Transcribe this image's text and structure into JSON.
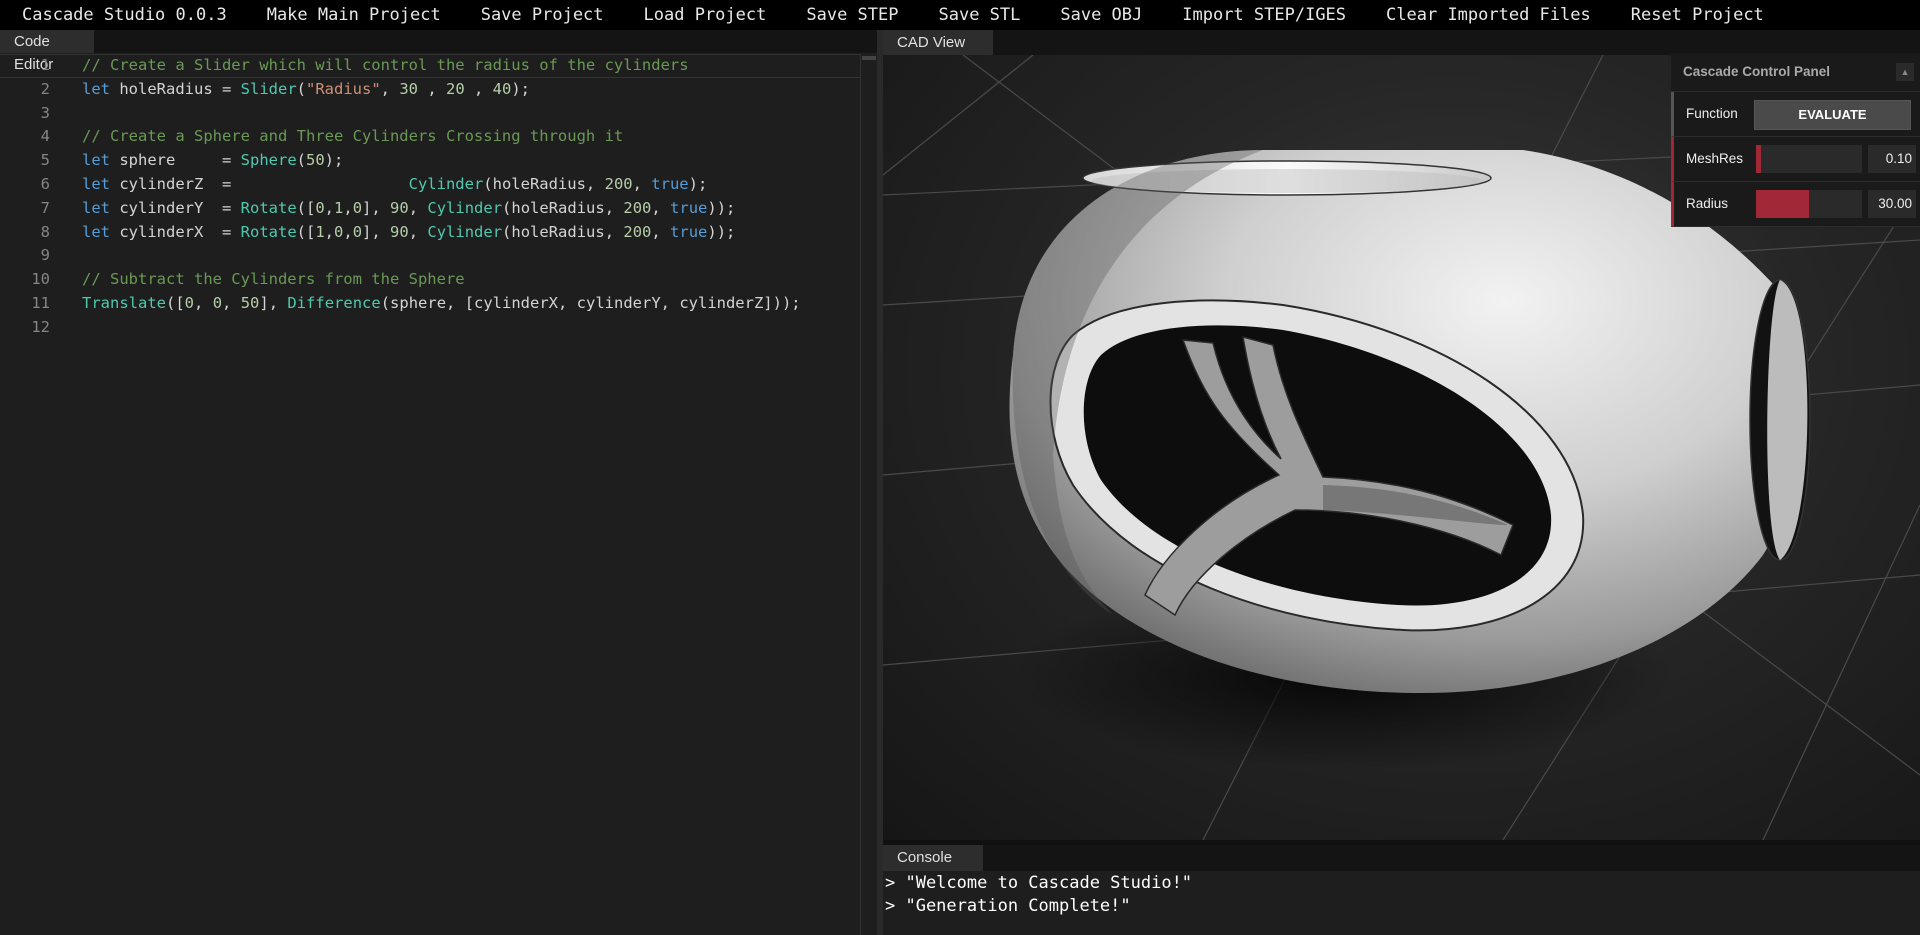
{
  "menu": {
    "app_title": "Cascade Studio 0.0.3",
    "items": [
      "Make Main Project",
      "Save Project",
      "Load Project",
      "Save STEP",
      "Save STL",
      "Save OBJ",
      "Import STEP/IGES",
      "Clear Imported Files",
      "Reset Project"
    ]
  },
  "editor": {
    "tab_label": "Code Editor",
    "lines": [
      {
        "n": "1",
        "tokens": [
          [
            "c-com",
            "// Create a Slider which will control the radius of the cylinders"
          ]
        ]
      },
      {
        "n": "2",
        "tokens": [
          [
            "c-kw",
            "let"
          ],
          [
            "c-id",
            " holeRadius = "
          ],
          [
            "c-fn",
            "Slider"
          ],
          [
            "c-id",
            "("
          ],
          [
            "c-str",
            "\"Radius\""
          ],
          [
            "c-id",
            ", "
          ],
          [
            "c-num",
            "30"
          ],
          [
            "c-id",
            " , "
          ],
          [
            "c-num",
            "20"
          ],
          [
            "c-id",
            " , "
          ],
          [
            "c-num",
            "40"
          ],
          [
            "c-id",
            ");"
          ]
        ]
      },
      {
        "n": "3",
        "tokens": []
      },
      {
        "n": "4",
        "tokens": [
          [
            "c-com",
            "// Create a Sphere and Three Cylinders Crossing through it"
          ]
        ]
      },
      {
        "n": "5",
        "tokens": [
          [
            "c-kw",
            "let"
          ],
          [
            "c-id",
            " sphere     = "
          ],
          [
            "c-fn",
            "Sphere"
          ],
          [
            "c-id",
            "("
          ],
          [
            "c-num",
            "50"
          ],
          [
            "c-id",
            ");"
          ]
        ]
      },
      {
        "n": "6",
        "tokens": [
          [
            "c-kw",
            "let"
          ],
          [
            "c-id",
            " cylinderZ  =                   "
          ],
          [
            "c-fn",
            "Cylinder"
          ],
          [
            "c-id",
            "(holeRadius, "
          ],
          [
            "c-num",
            "200"
          ],
          [
            "c-id",
            ", "
          ],
          [
            "c-kw",
            "true"
          ],
          [
            "c-id",
            ");"
          ]
        ]
      },
      {
        "n": "7",
        "tokens": [
          [
            "c-kw",
            "let"
          ],
          [
            "c-id",
            " cylinderY  = "
          ],
          [
            "c-fn",
            "Rotate"
          ],
          [
            "c-id",
            "(["
          ],
          [
            "c-num",
            "0"
          ],
          [
            "c-id",
            ","
          ],
          [
            "c-num",
            "1"
          ],
          [
            "c-id",
            ","
          ],
          [
            "c-num",
            "0"
          ],
          [
            "c-id",
            "], "
          ],
          [
            "c-num",
            "90"
          ],
          [
            "c-id",
            ", "
          ],
          [
            "c-fn",
            "Cylinder"
          ],
          [
            "c-id",
            "(holeRadius, "
          ],
          [
            "c-num",
            "200"
          ],
          [
            "c-id",
            ", "
          ],
          [
            "c-kw",
            "true"
          ],
          [
            "c-id",
            "));"
          ]
        ]
      },
      {
        "n": "8",
        "tokens": [
          [
            "c-kw",
            "let"
          ],
          [
            "c-id",
            " cylinderX  = "
          ],
          [
            "c-fn",
            "Rotate"
          ],
          [
            "c-id",
            "(["
          ],
          [
            "c-num",
            "1"
          ],
          [
            "c-id",
            ","
          ],
          [
            "c-num",
            "0"
          ],
          [
            "c-id",
            ","
          ],
          [
            "c-num",
            "0"
          ],
          [
            "c-id",
            "], "
          ],
          [
            "c-num",
            "90"
          ],
          [
            "c-id",
            ", "
          ],
          [
            "c-fn",
            "Cylinder"
          ],
          [
            "c-id",
            "(holeRadius, "
          ],
          [
            "c-num",
            "200"
          ],
          [
            "c-id",
            ", "
          ],
          [
            "c-kw",
            "true"
          ],
          [
            "c-id",
            "));"
          ]
        ]
      },
      {
        "n": "9",
        "tokens": []
      },
      {
        "n": "10",
        "tokens": [
          [
            "c-com",
            "// Subtract the Cylinders from the Sphere"
          ]
        ]
      },
      {
        "n": "11",
        "tokens": [
          [
            "c-fn",
            "Translate"
          ],
          [
            "c-id",
            "(["
          ],
          [
            "c-num",
            "0"
          ],
          [
            "c-id",
            ", "
          ],
          [
            "c-num",
            "0"
          ],
          [
            "c-id",
            ", "
          ],
          [
            "c-num",
            "50"
          ],
          [
            "c-id",
            "], "
          ],
          [
            "c-fn",
            "Difference"
          ],
          [
            "c-id",
            "(sphere, [cylinderX, cylinderY, cylinderZ]));"
          ]
        ]
      },
      {
        "n": "12",
        "tokens": []
      }
    ]
  },
  "cad": {
    "tab_label": "CAD View",
    "panel": {
      "title": "Cascade Control Panel",
      "function_label": "Function",
      "evaluate_label": "EVALUATE",
      "meshres_label": "MeshRes",
      "meshres_value": "0.10",
      "meshres_fill": 0.05,
      "radius_label": "Radius",
      "radius_value": "30.00",
      "radius_fill": 0.5
    }
  },
  "console": {
    "tab_label": "Console",
    "lines": [
      "> \"Welcome to Cascade Studio!\"",
      "> \"Generation Complete!\""
    ]
  }
}
